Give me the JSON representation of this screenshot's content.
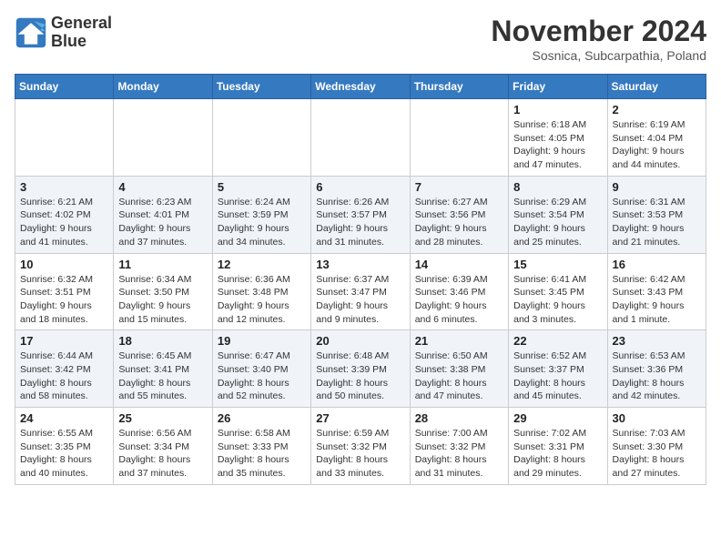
{
  "logo": {
    "line1": "General",
    "line2": "Blue"
  },
  "title": "November 2024",
  "subtitle": "Sosnica, Subcarpathia, Poland",
  "weekdays": [
    "Sunday",
    "Monday",
    "Tuesday",
    "Wednesday",
    "Thursday",
    "Friday",
    "Saturday"
  ],
  "weeks": [
    [
      {
        "day": "",
        "info": ""
      },
      {
        "day": "",
        "info": ""
      },
      {
        "day": "",
        "info": ""
      },
      {
        "day": "",
        "info": ""
      },
      {
        "day": "",
        "info": ""
      },
      {
        "day": "1",
        "info": "Sunrise: 6:18 AM\nSunset: 4:05 PM\nDaylight: 9 hours and 47 minutes."
      },
      {
        "day": "2",
        "info": "Sunrise: 6:19 AM\nSunset: 4:04 PM\nDaylight: 9 hours and 44 minutes."
      }
    ],
    [
      {
        "day": "3",
        "info": "Sunrise: 6:21 AM\nSunset: 4:02 PM\nDaylight: 9 hours and 41 minutes."
      },
      {
        "day": "4",
        "info": "Sunrise: 6:23 AM\nSunset: 4:01 PM\nDaylight: 9 hours and 37 minutes."
      },
      {
        "day": "5",
        "info": "Sunrise: 6:24 AM\nSunset: 3:59 PM\nDaylight: 9 hours and 34 minutes."
      },
      {
        "day": "6",
        "info": "Sunrise: 6:26 AM\nSunset: 3:57 PM\nDaylight: 9 hours and 31 minutes."
      },
      {
        "day": "7",
        "info": "Sunrise: 6:27 AM\nSunset: 3:56 PM\nDaylight: 9 hours and 28 minutes."
      },
      {
        "day": "8",
        "info": "Sunrise: 6:29 AM\nSunset: 3:54 PM\nDaylight: 9 hours and 25 minutes."
      },
      {
        "day": "9",
        "info": "Sunrise: 6:31 AM\nSunset: 3:53 PM\nDaylight: 9 hours and 21 minutes."
      }
    ],
    [
      {
        "day": "10",
        "info": "Sunrise: 6:32 AM\nSunset: 3:51 PM\nDaylight: 9 hours and 18 minutes."
      },
      {
        "day": "11",
        "info": "Sunrise: 6:34 AM\nSunset: 3:50 PM\nDaylight: 9 hours and 15 minutes."
      },
      {
        "day": "12",
        "info": "Sunrise: 6:36 AM\nSunset: 3:48 PM\nDaylight: 9 hours and 12 minutes."
      },
      {
        "day": "13",
        "info": "Sunrise: 6:37 AM\nSunset: 3:47 PM\nDaylight: 9 hours and 9 minutes."
      },
      {
        "day": "14",
        "info": "Sunrise: 6:39 AM\nSunset: 3:46 PM\nDaylight: 9 hours and 6 minutes."
      },
      {
        "day": "15",
        "info": "Sunrise: 6:41 AM\nSunset: 3:45 PM\nDaylight: 9 hours and 3 minutes."
      },
      {
        "day": "16",
        "info": "Sunrise: 6:42 AM\nSunset: 3:43 PM\nDaylight: 9 hours and 1 minute."
      }
    ],
    [
      {
        "day": "17",
        "info": "Sunrise: 6:44 AM\nSunset: 3:42 PM\nDaylight: 8 hours and 58 minutes."
      },
      {
        "day": "18",
        "info": "Sunrise: 6:45 AM\nSunset: 3:41 PM\nDaylight: 8 hours and 55 minutes."
      },
      {
        "day": "19",
        "info": "Sunrise: 6:47 AM\nSunset: 3:40 PM\nDaylight: 8 hours and 52 minutes."
      },
      {
        "day": "20",
        "info": "Sunrise: 6:48 AM\nSunset: 3:39 PM\nDaylight: 8 hours and 50 minutes."
      },
      {
        "day": "21",
        "info": "Sunrise: 6:50 AM\nSunset: 3:38 PM\nDaylight: 8 hours and 47 minutes."
      },
      {
        "day": "22",
        "info": "Sunrise: 6:52 AM\nSunset: 3:37 PM\nDaylight: 8 hours and 45 minutes."
      },
      {
        "day": "23",
        "info": "Sunrise: 6:53 AM\nSunset: 3:36 PM\nDaylight: 8 hours and 42 minutes."
      }
    ],
    [
      {
        "day": "24",
        "info": "Sunrise: 6:55 AM\nSunset: 3:35 PM\nDaylight: 8 hours and 40 minutes."
      },
      {
        "day": "25",
        "info": "Sunrise: 6:56 AM\nSunset: 3:34 PM\nDaylight: 8 hours and 37 minutes."
      },
      {
        "day": "26",
        "info": "Sunrise: 6:58 AM\nSunset: 3:33 PM\nDaylight: 8 hours and 35 minutes."
      },
      {
        "day": "27",
        "info": "Sunrise: 6:59 AM\nSunset: 3:32 PM\nDaylight: 8 hours and 33 minutes."
      },
      {
        "day": "28",
        "info": "Sunrise: 7:00 AM\nSunset: 3:32 PM\nDaylight: 8 hours and 31 minutes."
      },
      {
        "day": "29",
        "info": "Sunrise: 7:02 AM\nSunset: 3:31 PM\nDaylight: 8 hours and 29 minutes."
      },
      {
        "day": "30",
        "info": "Sunrise: 7:03 AM\nSunset: 3:30 PM\nDaylight: 8 hours and 27 minutes."
      }
    ]
  ]
}
